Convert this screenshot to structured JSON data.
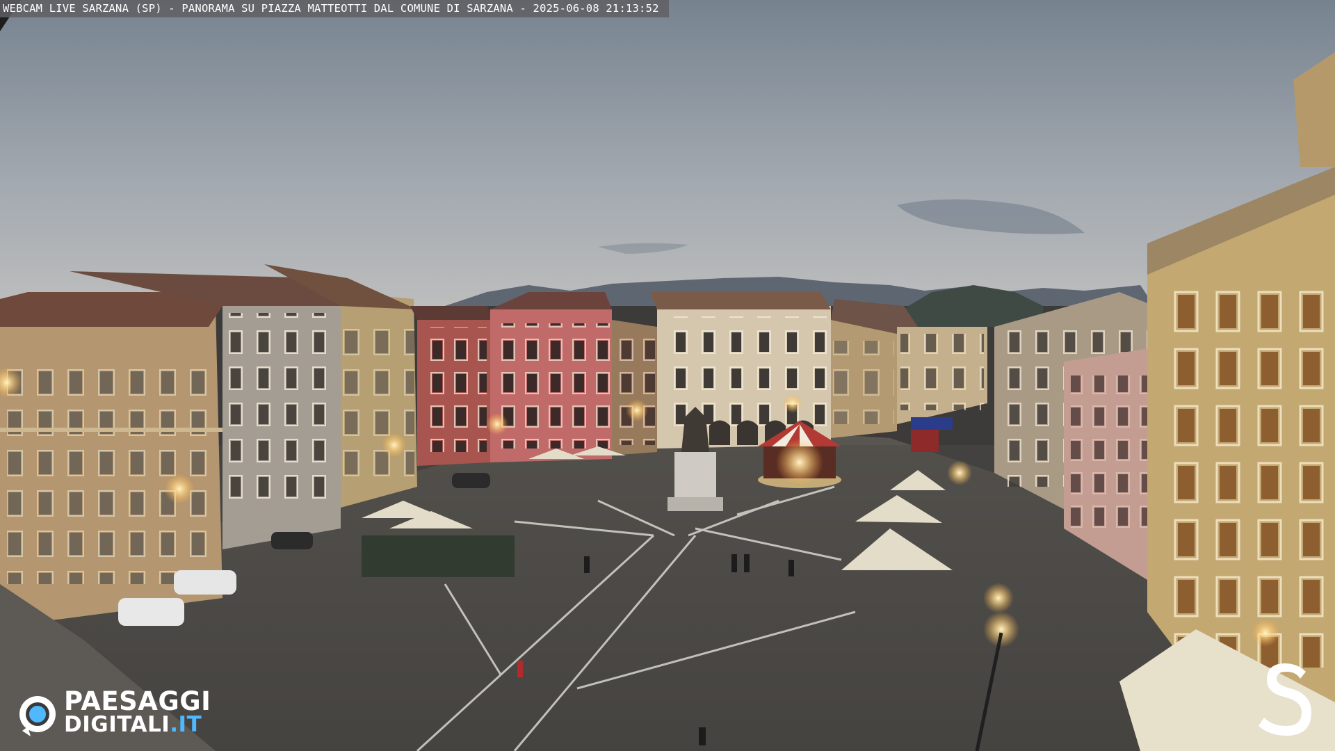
{
  "caption": {
    "text": "WEBCAM LIVE SARZANA (SP) - PANORAMA SU PIAZZA MATTEOTTI DAL COMUNE DI SARZANA - 2025-06-08  21:13:52"
  },
  "branding": {
    "logo_name": "PAESAGGI",
    "logo_sub": "DIGITALI",
    "logo_suffix": ".IT",
    "logo_icon": "camera-lens-icon",
    "corner_mark": "S",
    "accent_color": "#4fb8ff"
  },
  "colors": {
    "sky_top": "#7a8796",
    "sky_bottom": "#b4b8bc",
    "pavement": "#4a4846",
    "ochre_building": "#b99a6c",
    "red_building": "#b05a52",
    "pink_building": "#c46d6b",
    "cream_building": "#d8ccb6",
    "lamp_glow": "#ffd88a"
  }
}
